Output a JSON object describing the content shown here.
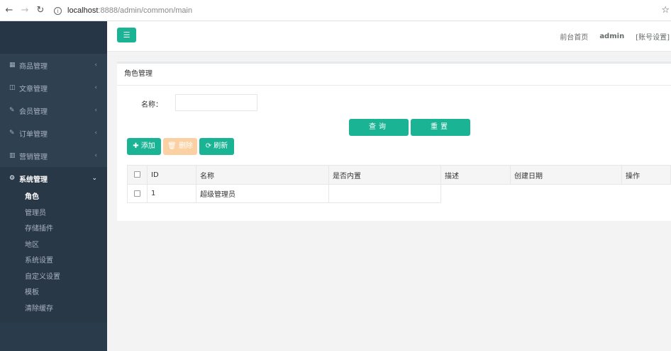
{
  "browser": {
    "back_icon": "back-arrow-icon",
    "forward_icon": "forward-arrow-icon",
    "reload_icon": "reload-icon",
    "url_host": "localhost",
    "url_path": ":8888/admin/common/main"
  },
  "sidebar": {
    "menu": [
      {
        "label": "商品管理",
        "icon": "table-icon"
      },
      {
        "label": "文章管理",
        "icon": "columns-icon"
      },
      {
        "label": "会员管理",
        "icon": "edit-icon"
      },
      {
        "label": "订单管理",
        "icon": "edit-icon"
      },
      {
        "label": "营销管理",
        "icon": "bar-chart-icon"
      }
    ],
    "active_menu": {
      "label": "系统管理",
      "icon": "gear-icon"
    },
    "submenu": [
      "角色",
      "管理员",
      "存储插件",
      "地区",
      "系统设置",
      "自定义设置",
      "模板",
      "清除缓存"
    ]
  },
  "topbar": {
    "links": [
      "前台首页",
      "admin",
      "[账号设置]"
    ]
  },
  "card": {
    "title": "角色管理",
    "form_label": "名称：",
    "search_label": "查询",
    "reset_label": "重置",
    "add_label": "添加",
    "delete_label": "删除",
    "refresh_label": "刷新"
  },
  "table": {
    "headers": [
      "ID",
      "名称",
      "是否内置",
      "描述",
      "创建日期",
      "操作"
    ],
    "rows": [
      {
        "id": "1",
        "name": "超级管理员",
        "builtin": "",
        "desc": "",
        "date": "",
        "ops": ""
      }
    ]
  },
  "colors": {
    "primary": "#1ab394",
    "sidebar": "#2f4050",
    "warning": "#f8ac59"
  }
}
